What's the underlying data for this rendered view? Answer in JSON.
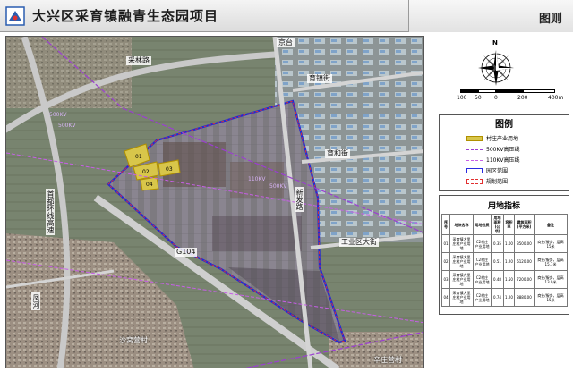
{
  "header": {
    "title": "大兴区采育镇融青生态园项目",
    "figure_label": "图则"
  },
  "map": {
    "road_labels": {
      "cailin": "采林路",
      "yuxian": "育镇街",
      "yuhe": "育和街",
      "gongye": "工业区大街",
      "jinghu": "京台",
      "xinfa": "新发路",
      "g104": "G104",
      "shouyi": "首都环线高速",
      "fengxian": "凤河"
    },
    "place_labels": {
      "shafeng": "沙窝营村",
      "xinzhuang": "辛庄营村"
    },
    "line_labels": {
      "l500a": "500KV",
      "l500b": "500KV",
      "l110": "110KV",
      "l500c": "500KV"
    }
  },
  "compass": {
    "north_label": "N",
    "scale_ticks": [
      "100",
      "50",
      "0",
      "200",
      "400m"
    ]
  },
  "legend": {
    "title": "图例",
    "items": [
      {
        "label": "村庄产业用地",
        "color": "#d8c64a"
      },
      {
        "label": "500KV高压线",
        "color": "#9b3fd1"
      },
      {
        "label": "110KV高压线",
        "color": "#c65fe6"
      },
      {
        "label": "园区范围",
        "color": "#2a2ae0"
      },
      {
        "label": "规划范围",
        "color": "#e23030"
      }
    ]
  },
  "land_index": {
    "title": "用地指标",
    "headers": [
      "序号",
      "地块名称",
      "用地性质",
      "用地面积(公顷)",
      "容积率",
      "建筑面积(平方米)",
      "备注"
    ],
    "rows": [
      [
        "01",
        "采育镇大里庄村产业用地",
        "C2村庄产业用地",
        "0.35",
        "1.00",
        "3500.00",
        "商业/服务，层高15米"
      ],
      [
        "02",
        "采育镇大里庄村产业用地",
        "C2村庄产业用地",
        "0.51",
        "1.20",
        "6120.00",
        "商业/服务，层高15.7米"
      ],
      [
        "03",
        "采育镇大里庄村产业用地",
        "C2村庄产业用地",
        "0.48",
        "1.50",
        "7200.00",
        "商业/服务，层高13.9米"
      ],
      [
        "04",
        "采育镇大里庄村产业用地",
        "C2村庄产业用地",
        "0.74",
        "1.20",
        "8880.00",
        "商业/服务，层高15米"
      ]
    ]
  }
}
